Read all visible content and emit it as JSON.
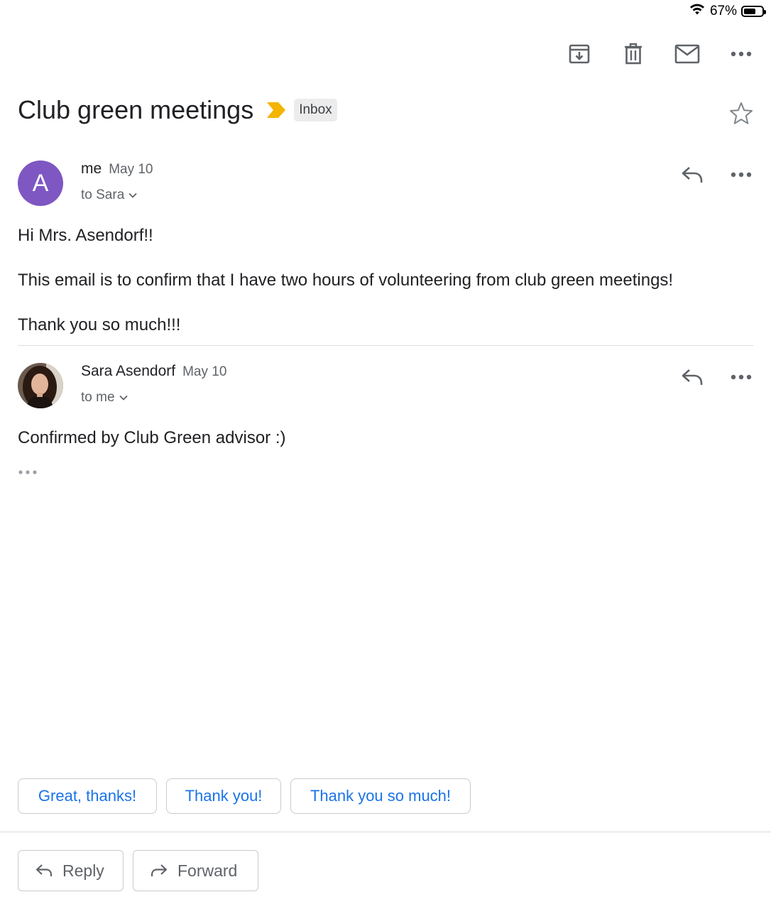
{
  "status_bar": {
    "battery_text": "67%",
    "battery_level": 0.67
  },
  "toolbar": {
    "archive_icon": "archive-icon",
    "delete_icon": "trash-icon",
    "mark_unread_icon": "mail-icon",
    "more_icon": "more-horizontal-icon"
  },
  "thread": {
    "subject": "Club green meetings",
    "label": "Inbox",
    "importance_color": "#f4b400"
  },
  "messages": [
    {
      "avatar_letter": "A",
      "avatar_color": "#7e57c2",
      "sender": "me",
      "date": "May 10",
      "recipient": "to Sara",
      "body": [
        "Hi Mrs. Asendorf!!",
        "This email is to confirm that I have two hours of volunteering from club green meetings!",
        "Thank you so much!!!"
      ]
    },
    {
      "sender": "Sara Asendorf",
      "date": "May 10",
      "recipient": "to me",
      "body": [
        "Confirmed by Club Green advisor :)"
      ]
    }
  ],
  "smart_replies": [
    "Great, thanks!",
    "Thank you!",
    "Thank you so much!"
  ],
  "actions": {
    "reply": "Reply",
    "forward": "Forward"
  },
  "colors": {
    "accent": "#1a73e8",
    "text": "#202124",
    "muted": "#5f6368"
  }
}
